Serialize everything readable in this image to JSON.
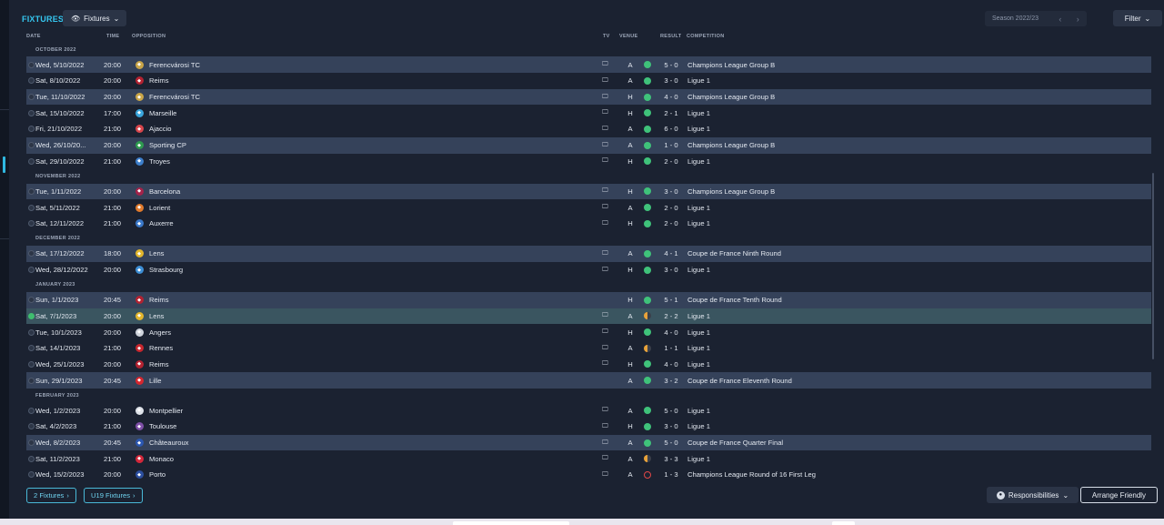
{
  "header": {
    "title": "FIXTURES",
    "view_label": "Fixtures",
    "season_label": "Season 2022/23",
    "filter_label": "Filter"
  },
  "columns": {
    "date": "DATE",
    "time": "TIME",
    "opposition": "OPPOSITION",
    "tv": "TV",
    "venue": "VENUE",
    "result": "RESULT",
    "competition": "COMPETITION"
  },
  "months": [
    {
      "label": "OCTOBER 2022",
      "fixtures": [
        {
          "date": "Wed, 5/10/2022",
          "time": "20:00",
          "opp": "Ferencvárosi TC",
          "crest_color": "#c9a548",
          "tv": true,
          "venue": "A",
          "outcome": "win",
          "result": "5 - 0",
          "comp": "Champions League Group B",
          "style": "alt"
        },
        {
          "date": "Sat, 8/10/2022",
          "time": "20:00",
          "opp": "Reims",
          "crest_color": "#b32231",
          "tv": true,
          "venue": "A",
          "outcome": "win",
          "result": "3 - 0",
          "comp": "Ligue 1",
          "style": ""
        },
        {
          "date": "Tue, 11/10/2022",
          "time": "20:00",
          "opp": "Ferencvárosi TC",
          "crest_color": "#c9a548",
          "tv": true,
          "venue": "H",
          "outcome": "win",
          "result": "4 - 0",
          "comp": "Champions League Group B",
          "style": "alt"
        },
        {
          "date": "Sat, 15/10/2022",
          "time": "17:00",
          "opp": "Marseille",
          "crest_color": "#3aa6dd",
          "tv": true,
          "venue": "H",
          "outcome": "win",
          "result": "2 - 1",
          "comp": "Ligue 1",
          "style": ""
        },
        {
          "date": "Fri, 21/10/2022",
          "time": "21:00",
          "opp": "Ajaccio",
          "crest_color": "#d8454b",
          "tv": true,
          "venue": "A",
          "outcome": "win",
          "result": "6 - 0",
          "comp": "Ligue 1",
          "style": ""
        },
        {
          "date": "Wed, 26/10/20...",
          "time": "20:00",
          "opp": "Sporting CP",
          "crest_color": "#2e9b4f",
          "tv": true,
          "venue": "A",
          "outcome": "win",
          "result": "1 - 0",
          "comp": "Champions League Group B",
          "style": "alt"
        },
        {
          "date": "Sat, 29/10/2022",
          "time": "21:00",
          "opp": "Troyes",
          "crest_color": "#3d7fcb",
          "tv": true,
          "venue": "H",
          "outcome": "win",
          "result": "2 - 0",
          "comp": "Ligue 1",
          "style": ""
        }
      ]
    },
    {
      "label": "NOVEMBER 2022",
      "fixtures": [
        {
          "date": "Tue, 1/11/2022",
          "time": "20:00",
          "opp": "Barcelona",
          "crest_color": "#a3234a",
          "tv": true,
          "venue": "H",
          "outcome": "win",
          "result": "3 - 0",
          "comp": "Champions League Group B",
          "style": "alt"
        },
        {
          "date": "Sat, 5/11/2022",
          "time": "21:00",
          "opp": "Lorient",
          "crest_color": "#e07a2c",
          "tv": true,
          "venue": "A",
          "outcome": "win",
          "result": "2 - 0",
          "comp": "Ligue 1",
          "style": ""
        },
        {
          "date": "Sat, 12/11/2022",
          "time": "21:00",
          "opp": "Auxerre",
          "crest_color": "#3a78c9",
          "tv": true,
          "venue": "H",
          "outcome": "win",
          "result": "2 - 0",
          "comp": "Ligue 1",
          "style": ""
        }
      ]
    },
    {
      "label": "DECEMBER 2022",
      "fixtures": [
        {
          "date": "Sat, 17/12/2022",
          "time": "18:00",
          "opp": "Lens",
          "crest_color": "#e2b62c",
          "tv": true,
          "venue": "A",
          "outcome": "win",
          "result": "4 - 1",
          "comp": "Coupe de France Ninth Round",
          "style": "alt"
        },
        {
          "date": "Wed, 28/12/2022",
          "time": "20:00",
          "opp": "Strasbourg",
          "crest_color": "#3d8fd6",
          "tv": true,
          "venue": "H",
          "outcome": "win",
          "result": "3 - 0",
          "comp": "Ligue 1",
          "style": ""
        }
      ]
    },
    {
      "label": "JANUARY 2023",
      "fixtures": [
        {
          "date": "Sun, 1/1/2023",
          "time": "20:45",
          "opp": "Reims",
          "crest_color": "#b32231",
          "tv": false,
          "venue": "H",
          "outcome": "win",
          "result": "5 - 1",
          "comp": "Coupe de France Tenth Round",
          "style": "alt"
        },
        {
          "date": "Sat, 7/1/2023",
          "time": "20:00",
          "opp": "Lens",
          "crest_color": "#e2b62c",
          "tv": true,
          "venue": "A",
          "outcome": "draw",
          "result": "2 - 2",
          "comp": "Ligue 1",
          "style": "sel",
          "done": true
        },
        {
          "date": "Tue, 10/1/2023",
          "time": "20:00",
          "opp": "Angers",
          "crest_color": "#cfd4dc",
          "tv": true,
          "venue": "H",
          "outcome": "win",
          "result": "4 - 0",
          "comp": "Ligue 1",
          "style": ""
        },
        {
          "date": "Sat, 14/1/2023",
          "time": "21:00",
          "opp": "Rennes",
          "crest_color": "#c7262d",
          "tv": true,
          "venue": "A",
          "outcome": "draw",
          "result": "1 - 1",
          "comp": "Ligue 1",
          "style": ""
        },
        {
          "date": "Wed, 25/1/2023",
          "time": "20:00",
          "opp": "Reims",
          "crest_color": "#b32231",
          "tv": true,
          "venue": "H",
          "outcome": "win",
          "result": "4 - 0",
          "comp": "Ligue 1",
          "style": ""
        },
        {
          "date": "Sun, 29/1/2023",
          "time": "20:45",
          "opp": "Lille",
          "crest_color": "#d6272f",
          "tv": false,
          "venue": "A",
          "outcome": "win",
          "result": "3 - 2",
          "comp": "Coupe de France Eleventh Round",
          "style": "alt"
        }
      ]
    },
    {
      "label": "FEBRUARY 2023",
      "fixtures": [
        {
          "date": "Wed, 1/2/2023",
          "time": "20:00",
          "opp": "Montpellier",
          "crest_color": "#dfe3ea",
          "tv": true,
          "venue": "A",
          "outcome": "win",
          "result": "5 - 0",
          "comp": "Ligue 1",
          "style": ""
        },
        {
          "date": "Sat, 4/2/2023",
          "time": "21:00",
          "opp": "Toulouse",
          "crest_color": "#7e4fa6",
          "tv": true,
          "venue": "H",
          "outcome": "win",
          "result": "3 - 0",
          "comp": "Ligue 1",
          "style": ""
        },
        {
          "date": "Wed, 8/2/2023",
          "time": "20:45",
          "opp": "Châteauroux",
          "crest_color": "#2b57b0",
          "tv": true,
          "venue": "A",
          "outcome": "win",
          "result": "5 - 0",
          "comp": "Coupe de France Quarter Final",
          "style": "alt"
        },
        {
          "date": "Sat, 11/2/2023",
          "time": "21:00",
          "opp": "Monaco",
          "crest_color": "#d3273a",
          "tv": true,
          "venue": "A",
          "outcome": "draw",
          "result": "3 - 3",
          "comp": "Ligue 1",
          "style": ""
        },
        {
          "date": "Wed, 15/2/2023",
          "time": "20:00",
          "opp": "Porto",
          "crest_color": "#2c4fa0",
          "tv": true,
          "venue": "A",
          "outcome": "loss",
          "result": "1 - 3",
          "comp": "Champions League Round of 16  First Leg",
          "style": ""
        }
      ]
    }
  ],
  "footer": {
    "fixtures_link": "2 Fixtures",
    "u19_link": "U19 Fixtures",
    "responsibilities": "Responsibilities",
    "arrange_friendly": "Arrange Friendly"
  }
}
